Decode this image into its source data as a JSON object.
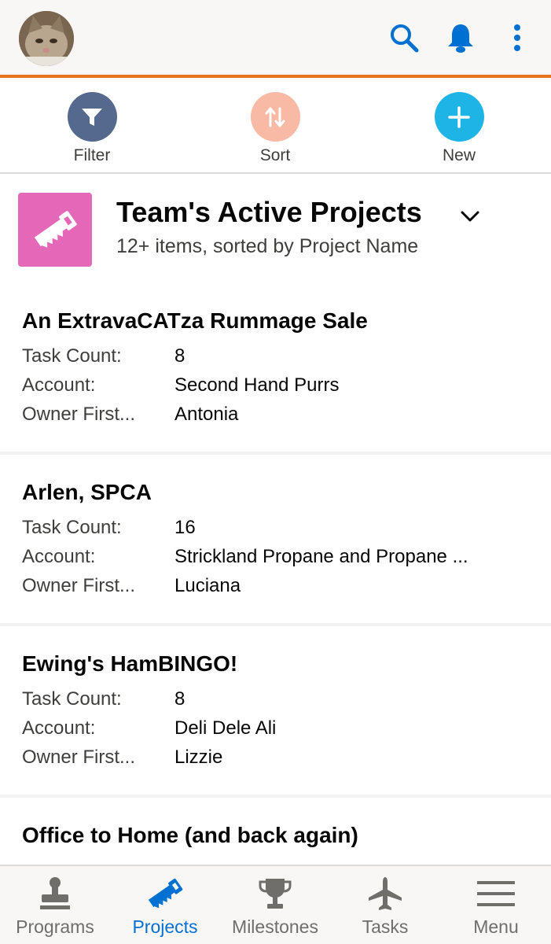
{
  "header": {
    "avatar_alt": "User avatar"
  },
  "actions": {
    "filter": "Filter",
    "sort": "Sort",
    "new": "New"
  },
  "list": {
    "title": "Team's Active Projects",
    "subtitle": "12+ items, sorted by Project Name"
  },
  "labels": {
    "task_count": "Task Count:",
    "account": "Account:",
    "owner": "Owner First..."
  },
  "records": [
    {
      "name": "An ExtravaCATza Rummage Sale",
      "task_count": "8",
      "account": "Second Hand Purrs",
      "owner": "Antonia"
    },
    {
      "name": "Arlen, SPCA",
      "task_count": "16",
      "account": "Strickland Propane and Propane ...",
      "owner": "Luciana"
    },
    {
      "name": "Ewing's HamBINGO!",
      "task_count": "8",
      "account": "Deli Dele Ali",
      "owner": "Lizzie"
    },
    {
      "name": "Office to Home (and back again)"
    }
  ],
  "tabs": {
    "programs": "Programs",
    "projects": "Projects",
    "milestones": "Milestones",
    "tasks": "Tasks",
    "menu": "Menu"
  },
  "colors": {
    "brand_blue": "#0070d2",
    "header_accent": "#e8731e",
    "filter": "#54698d",
    "sort": "#f8b9a5",
    "new": "#1fb4e6",
    "list_icon": "#e468b7"
  }
}
